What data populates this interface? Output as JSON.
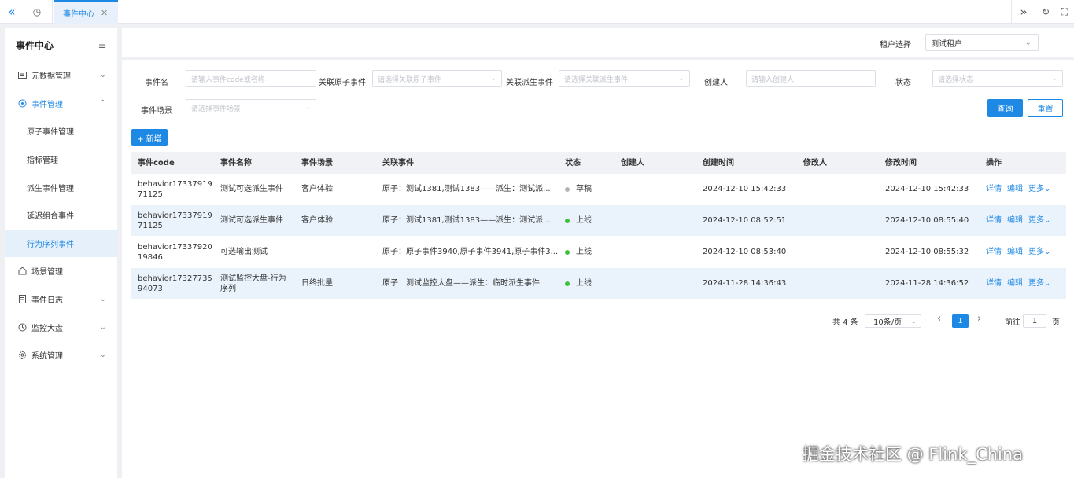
{
  "tabs": {
    "active_label": "事件中心",
    "close_glyph": "✕",
    "collapse_glyph": "«",
    "expand_glyph": "»",
    "refresh_glyph": "↻",
    "fullscreen_glyph": "⛶",
    "dashboard_glyph": "◷"
  },
  "sidebar": {
    "title": "事件中心",
    "menu_glyph": "☰",
    "chevron_down": "⌄",
    "chevron_up": "⌃",
    "items": [
      {
        "label": "元数据管理",
        "icon": "metadata-icon"
      },
      {
        "label": "事件管理",
        "icon": "event-icon"
      },
      {
        "label": "场景管理",
        "icon": "home-icon"
      },
      {
        "label": "事件日志",
        "icon": "log-icon"
      },
      {
        "label": "监控大盘",
        "icon": "clock-icon"
      },
      {
        "label": "系统管理",
        "icon": "gear-icon"
      }
    ],
    "sub_items": [
      {
        "label": "原子事件管理"
      },
      {
        "label": "指标管理"
      },
      {
        "label": "派生事件管理"
      },
      {
        "label": "延迟组合事件"
      },
      {
        "label": "行为序列事件"
      }
    ]
  },
  "tenant": {
    "label": "租户选择",
    "value": "测试租户"
  },
  "filters": {
    "event_name": {
      "label": "事件名",
      "placeholder": "请输入事件code或名称"
    },
    "atomic": {
      "label": "关联原子事件",
      "placeholder": "请选择关联原子事件"
    },
    "derived": {
      "label": "关联派生事件",
      "placeholder": "请选择关联派生事件"
    },
    "creator": {
      "label": "创建人",
      "placeholder": "请输入创建人"
    },
    "status": {
      "label": "状态",
      "placeholder": "请选择状态"
    },
    "scene": {
      "label": "事件场景",
      "placeholder": "请选择事件场景"
    },
    "query_label": "查询",
    "reset_label": "重置"
  },
  "add_button": {
    "label": "+ 新增"
  },
  "table": {
    "headers": [
      "事件code",
      "事件名称",
      "事件场景",
      "关联事件",
      "状态",
      "创建人",
      "创建时间",
      "修改人",
      "修改时间",
      "操作"
    ],
    "rows": [
      {
        "code": "behavior1733791971125",
        "code_l1": "behavior17337919",
        "code_l2": "71125",
        "name": "测试可选派生事件",
        "name_l2": "",
        "scene": "客户体验",
        "related": "原子：测试1381,测试1383——派生：测试派...",
        "status": "草稿",
        "status_color": "#b0b3b8",
        "creator": "",
        "created": "2024-12-10 15:42:33",
        "modifier": "",
        "modified": "2024-12-10 15:42:33"
      },
      {
        "code": "behavior1733791971125",
        "code_l1": "behavior17337919",
        "code_l2": "71125",
        "name": "测试可选派生事件",
        "name_l2": "",
        "scene": "客户体验",
        "related": "原子：测试1381,测试1383——派生：测试派...",
        "status": "上线",
        "status_color": "#3cc13b",
        "creator": "",
        "created": "2024-12-10 08:52:51",
        "modifier": "",
        "modified": "2024-12-10 08:55:40"
      },
      {
        "code": "behavior1733792019846",
        "code_l1": "behavior17337920",
        "code_l2": "19846",
        "name": "可选输出测试",
        "name_l2": "",
        "scene": "",
        "related": "原子：原子事件3940,原子事件3941,原子事件3...",
        "status": "上线",
        "status_color": "#3cc13b",
        "creator": "",
        "created": "2024-12-10 08:53:40",
        "modifier": "",
        "modified": "2024-12-10 08:55:32"
      },
      {
        "code": "behavior1732773594073",
        "code_l1": "behavior17327735",
        "code_l2": "94073",
        "name": "测试监控大盘-行为",
        "name_l2": "序列",
        "scene": "日终批量",
        "related": "原子：测试监控大盘——派生：临时派生事件",
        "status": "上线",
        "status_color": "#3cc13b",
        "creator": "",
        "created": "2024-11-28 14:36:43",
        "modifier": "",
        "modified": "2024-11-28 14:36:52"
      }
    ],
    "ops": {
      "detail": "详情",
      "edit": "编辑",
      "more": "更多⌄"
    }
  },
  "pagination": {
    "total": "共 4 条",
    "page_size": "10条/页",
    "current": "1",
    "goto_prefix": "前往",
    "goto_value": "1",
    "goto_suffix": "页",
    "prev": "‹",
    "next": "›"
  },
  "watermark": "掘金技术社区 @ Flink_China",
  "colors": {
    "accent": "#1e88e5",
    "online": "#3cc13b",
    "draft": "#b0b3b8"
  }
}
